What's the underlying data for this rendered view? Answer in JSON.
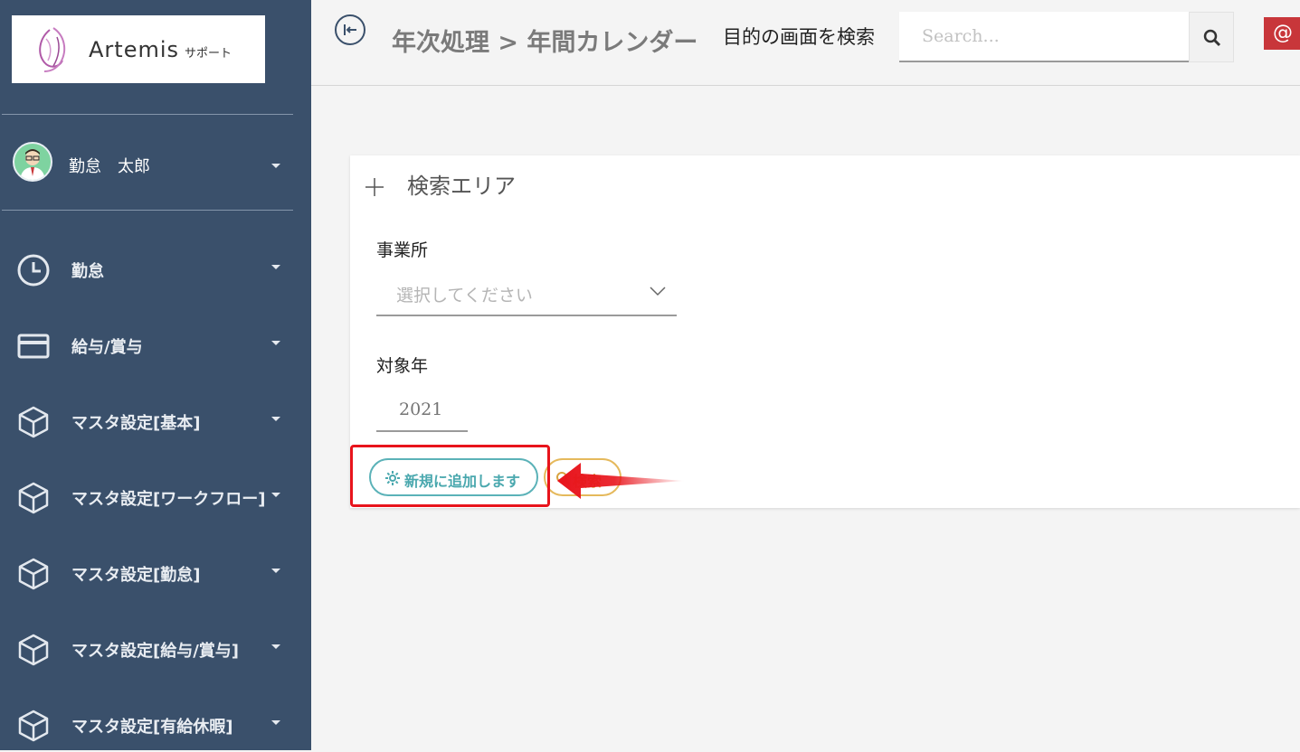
{
  "sidebar": {
    "logo": {
      "name": "Artemis",
      "sub": "サポート"
    },
    "user": {
      "name": "勤怠　太郎"
    },
    "items": [
      {
        "label": "勤怠",
        "icon": "clock-icon"
      },
      {
        "label": "給与/賞与",
        "icon": "credit-card-icon"
      },
      {
        "label": "マスタ設定[基本]",
        "icon": "cube-icon"
      },
      {
        "label": "マスタ設定[ワークフロー]",
        "icon": "cube-icon"
      },
      {
        "label": "マスタ設定[勤怠]",
        "icon": "cube-icon"
      },
      {
        "label": "マスタ設定[給与/賞与]",
        "icon": "cube-icon"
      },
      {
        "label": "マスタ設定[有給休暇]",
        "icon": "cube-icon"
      }
    ]
  },
  "header": {
    "breadcrumb": "年次処理 > 年間カレンダー",
    "search_label": "目的の画面を検索",
    "search_placeholder": "Search...",
    "at_label": "@"
  },
  "search_area": {
    "title": "検索エリア",
    "office_label": "事業所",
    "office_placeholder": "選択してください",
    "year_label": "対象年",
    "year_placeholder": "2021",
    "add_button": "新規に追加します",
    "search_button": "検索"
  },
  "colors": {
    "sidebar_bg": "#3a506b",
    "add_button": "#5bb2b8",
    "search_button": "#e5b95c",
    "highlight": "#e8141c",
    "at_button": "#c8363a"
  }
}
